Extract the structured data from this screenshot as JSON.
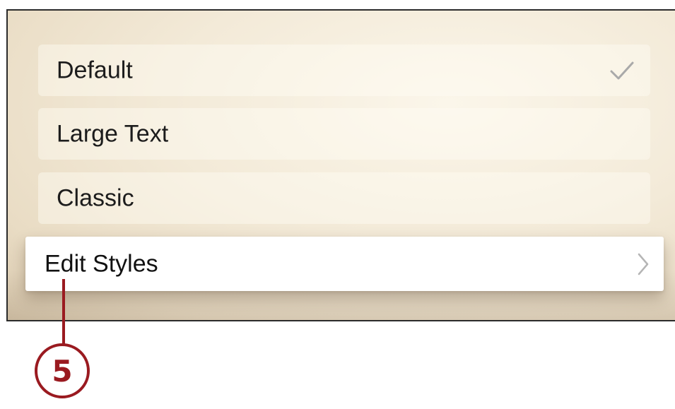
{
  "styles_list": {
    "items": [
      {
        "label": "Default",
        "selected": true,
        "icon": "checkmark-icon"
      },
      {
        "label": "Large Text",
        "selected": false
      },
      {
        "label": "Classic",
        "selected": false
      }
    ],
    "edit_row": {
      "label": "Edit Styles",
      "icon": "chevron-right-icon"
    }
  },
  "callout": {
    "number": "5",
    "color": "#9a1a20"
  },
  "colors": {
    "background": "#f3ead8",
    "row_highlight": "#ffffff",
    "checkmark": "#a9a9a9",
    "chevron": "#b5b5b5"
  }
}
